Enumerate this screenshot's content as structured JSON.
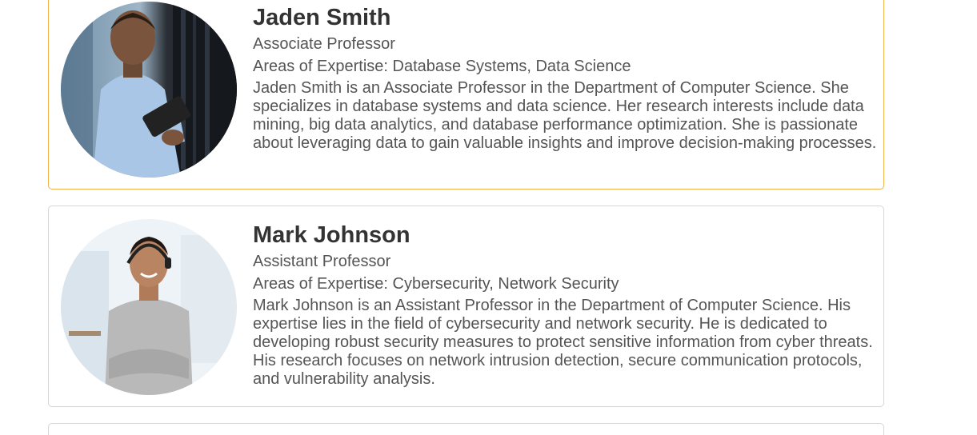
{
  "faculty": [
    {
      "name": "Jaden Smith",
      "title": "Associate Professor",
      "expertise": "Areas of Expertise: Database Systems, Data Science",
      "bio": "Jaden Smith is an Associate Professor in the Department of Computer Science. She specializes in database systems and data science. Her research interests include data mining, big data analytics, and database performance optimization. She is passionate about leveraging data to gain valuable insights and improve decision-making processes.",
      "photo": "portrait-photo"
    },
    {
      "name": "Mark Johnson",
      "title": "Assistant Professor",
      "expertise": "Areas of Expertise: Cybersecurity, Network Security",
      "bio": "Mark Johnson is an Assistant Professor in the Department of Computer Science. His expertise lies in the field of cybersecurity and network security. He is dedicated to developing robust security measures to protect sensitive information from cyber threats. His research focuses on network intrusion detection, secure communication protocols, and vulnerability analysis.",
      "photo": "portrait-photo"
    }
  ],
  "colors": {
    "highlight_border": "#f0b24a",
    "card_border": "#d6d6d6",
    "name_text": "#333333",
    "body_text": "#555555"
  }
}
